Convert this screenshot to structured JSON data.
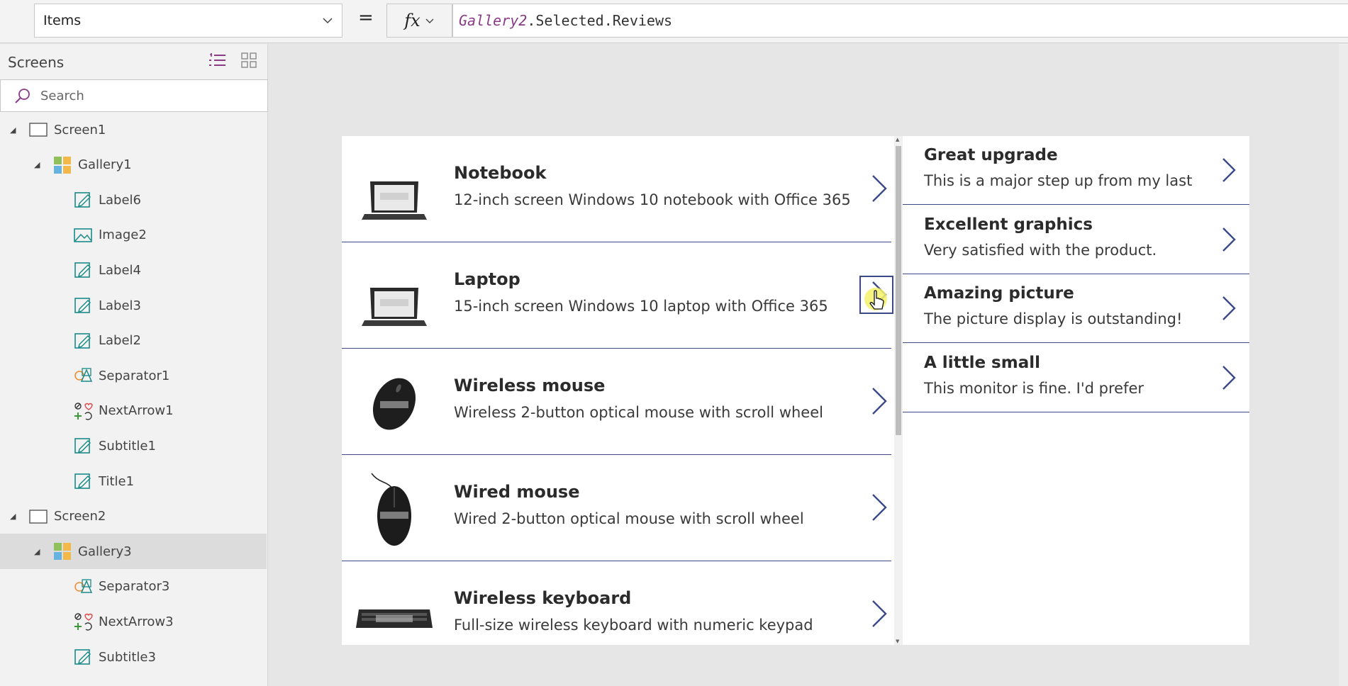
{
  "formula": {
    "property": "Items",
    "equals": "=",
    "fx_label": "fx",
    "expression_ref": "Gallery2",
    "expression_rest": ".Selected.Reviews"
  },
  "tree": {
    "title": "Screens",
    "search_placeholder": "Search",
    "nodes": [
      {
        "label": "Screen1",
        "type": "screen"
      },
      {
        "label": "Gallery1",
        "type": "gallery"
      },
      {
        "label": "Label6",
        "type": "label"
      },
      {
        "label": "Image2",
        "type": "image"
      },
      {
        "label": "Label4",
        "type": "label"
      },
      {
        "label": "Label3",
        "type": "label"
      },
      {
        "label": "Label2",
        "type": "label"
      },
      {
        "label": "Separator1",
        "type": "separator"
      },
      {
        "label": "NextArrow1",
        "type": "icon"
      },
      {
        "label": "Subtitle1",
        "type": "label"
      },
      {
        "label": "Title1",
        "type": "label"
      },
      {
        "label": "Screen2",
        "type": "screen"
      },
      {
        "label": "Gallery3",
        "type": "gallery",
        "selected": true
      },
      {
        "label": "Separator3",
        "type": "separator"
      },
      {
        "label": "NextArrow3",
        "type": "icon"
      },
      {
        "label": "Subtitle3",
        "type": "label"
      }
    ]
  },
  "products": [
    {
      "title": "Notebook",
      "subtitle": "12-inch screen Windows 10 notebook with Office 365",
      "image": "laptop-image"
    },
    {
      "title": "Laptop",
      "subtitle": "15-inch screen Windows 10 laptop with Office 365",
      "image": "laptop-image"
    },
    {
      "title": "Wireless mouse",
      "subtitle": "Wireless 2-button optical mouse with scroll wheel",
      "image": "mouse-image"
    },
    {
      "title": "Wired mouse",
      "subtitle": "Wired 2-button optical mouse with scroll wheel",
      "image": "wired-mouse-image"
    },
    {
      "title": "Wireless keyboard",
      "subtitle": "Full-size wireless keyboard with numeric keypad",
      "image": "keyboard-image"
    }
  ],
  "reviews": [
    {
      "title": "Great upgrade",
      "subtitle": "This is a major step up from my last"
    },
    {
      "title": "Excellent graphics",
      "subtitle": "Very satisfied with the product."
    },
    {
      "title": "Amazing picture",
      "subtitle": "The picture display is outstanding!"
    },
    {
      "title": "A little small",
      "subtitle": "This monitor is fine. I'd prefer"
    }
  ],
  "colors": {
    "accent": "#3b4a87",
    "formula_ref": "#8a3b87",
    "tree_icon_purple": "#8a3b87",
    "tree_icon_teal": "#1a8a8a"
  }
}
